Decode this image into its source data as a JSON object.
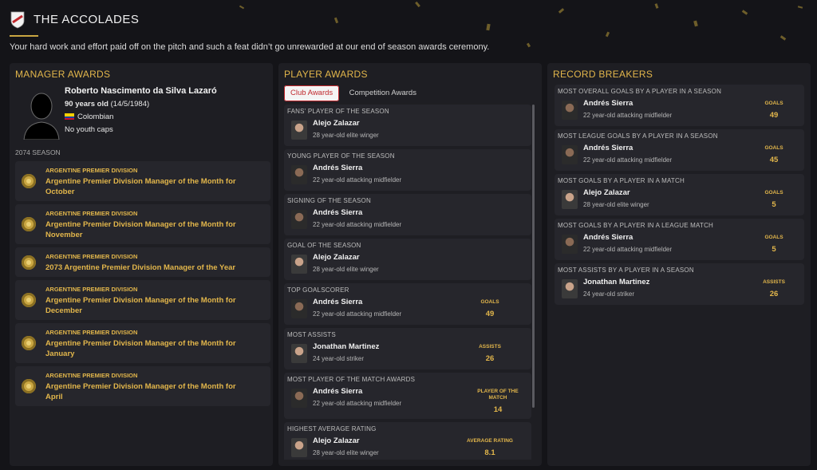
{
  "header": {
    "title": "THE ACCOLADES",
    "subtitle": "Your hard work and effort paid off on the pitch and such a feat didn’t go unrewarded at our end of season awards ceremony."
  },
  "manager_awards": {
    "title": "MANAGER AWARDS",
    "name": "Roberto Nascimento da Silva Lazaró",
    "age": "90 years old",
    "dob": "(14/5/1984)",
    "nationality": "Colombian",
    "caps": "No youth caps",
    "season": "2074 SEASON",
    "awards": [
      {
        "competition": "ARGENTINE PREMIER DIVISION",
        "name": "Argentine Premier Division Manager of the Month for October"
      },
      {
        "competition": "ARGENTINE PREMIER DIVISION",
        "name": "Argentine Premier Division Manager of the Month for November"
      },
      {
        "competition": "ARGENTINE PREMIER DIVISION",
        "name": "2073 Argentine Premier Division Manager of the Year"
      },
      {
        "competition": "ARGENTINE PREMIER DIVISION",
        "name": "Argentine Premier Division Manager of the Month for December"
      },
      {
        "competition": "ARGENTINE PREMIER DIVISION",
        "name": "Argentine Premier Division Manager of the Month for January"
      },
      {
        "competition": "ARGENTINE PREMIER DIVISION",
        "name": "Argentine Premier Division Manager of the Month for April"
      }
    ]
  },
  "player_awards": {
    "title": "PLAYER AWARDS",
    "tabs": [
      "Club Awards",
      "Competition Awards"
    ],
    "items": [
      {
        "category": "FANS' PLAYER OF THE SEASON",
        "player": "Alejo Zalazar",
        "desc": "28 year-old elite winger",
        "stat_label": "",
        "stat_value": ""
      },
      {
        "category": "YOUNG PLAYER OF THE SEASON",
        "player": "Andrés Sierra",
        "desc": "22 year-old attacking midfielder",
        "stat_label": "",
        "stat_value": ""
      },
      {
        "category": "SIGNING OF THE SEASON",
        "player": "Andrés Sierra",
        "desc": "22 year-old attacking midfielder",
        "stat_label": "",
        "stat_value": ""
      },
      {
        "category": "GOAL OF THE SEASON",
        "player": "Alejo Zalazar",
        "desc": "28 year-old elite winger",
        "stat_label": "",
        "stat_value": ""
      },
      {
        "category": "TOP GOALSCORER",
        "player": "Andrés Sierra",
        "desc": "22 year-old attacking midfielder",
        "stat_label": "GOALS",
        "stat_value": "49"
      },
      {
        "category": "MOST ASSISTS",
        "player": "Jonathan Martinez",
        "desc": "24 year-old striker",
        "stat_label": "ASSISTS",
        "stat_value": "26"
      },
      {
        "category": "MOST PLAYER OF THE MATCH AWARDS",
        "player": "Andrés Sierra",
        "desc": "22 year-old attacking midfielder",
        "stat_label": "PLAYER OF THE MATCH",
        "stat_value": "14"
      },
      {
        "category": "HIGHEST AVERAGE RATING",
        "player": "Alejo Zalazar",
        "desc": "28 year-old elite winger",
        "stat_label": "AVERAGE RATING",
        "stat_value": "8.1"
      }
    ]
  },
  "record_breakers": {
    "title": "RECORD BREAKERS",
    "items": [
      {
        "category": "MOST OVERALL GOALS BY A PLAYER IN A SEASON",
        "player": "Andrés Sierra",
        "desc": "22 year-old attacking midfielder",
        "stat_label": "GOALS",
        "stat_value": "49"
      },
      {
        "category": "MOST LEAGUE GOALS BY A PLAYER IN A SEASON",
        "player": "Andrés Sierra",
        "desc": "22 year-old attacking midfielder",
        "stat_label": "GOALS",
        "stat_value": "45"
      },
      {
        "category": "MOST GOALS BY A PLAYER IN A MATCH",
        "player": "Alejo Zalazar",
        "desc": "28 year-old elite winger",
        "stat_label": "GOALS",
        "stat_value": "5"
      },
      {
        "category": "MOST GOALS BY A PLAYER IN A LEAGUE MATCH",
        "player": "Andrés Sierra",
        "desc": "22 year-old attacking midfielder",
        "stat_label": "GOALS",
        "stat_value": "5"
      },
      {
        "category": "MOST ASSISTS BY A PLAYER IN A SEASON",
        "player": "Jonathan Martinez",
        "desc": "24 year-old striker",
        "stat_label": "ASSISTS",
        "stat_value": "26"
      }
    ]
  }
}
